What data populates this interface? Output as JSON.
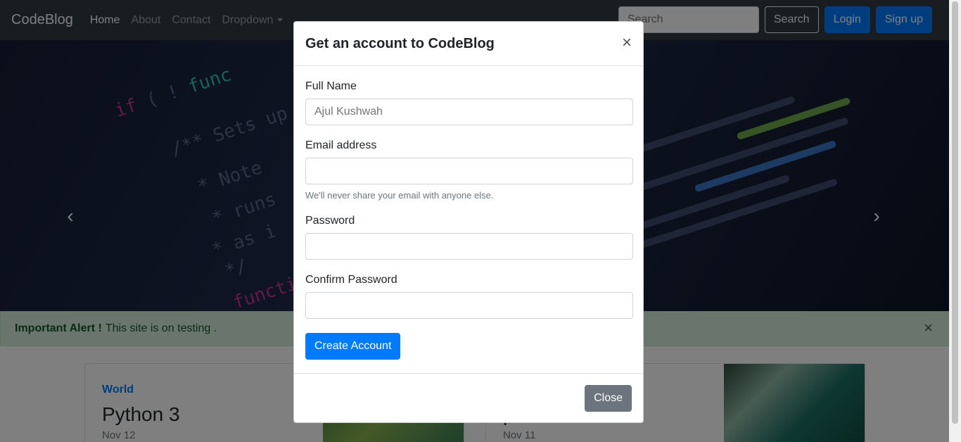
{
  "navbar": {
    "brand": "CodeBlog",
    "links": [
      {
        "label": "Home"
      },
      {
        "label": "About"
      },
      {
        "label": "Contact"
      },
      {
        "label": "Dropdown"
      }
    ],
    "search_placeholder": "Search",
    "search_button": "Search",
    "login_button": "Login",
    "signup_button": "Sign up"
  },
  "carousel": {
    "prev_icon": "chevron-left-icon",
    "next_icon": "chevron-right-icon"
  },
  "alert": {
    "strong": "Important Alert !",
    "text": "This site is on testing .",
    "close": "×"
  },
  "cards": [
    {
      "category": "World",
      "title": "Python 3",
      "date": "Nov 12"
    },
    {
      "category": "",
      "title": "p",
      "date": "Nov 11"
    }
  ],
  "modal": {
    "title": "Get an account to CodeBlog",
    "close_x": "×",
    "fields": {
      "full_name": {
        "label": "Full Name",
        "placeholder": "Ajul Kushwah"
      },
      "email": {
        "label": "Email address",
        "help": "We'll never share your email with anyone else."
      },
      "password": {
        "label": "Password"
      },
      "confirm_password": {
        "label": "Confirm Password"
      }
    },
    "submit": "Create Account",
    "close": "Close"
  },
  "colors": {
    "navbar_bg": "#343a40",
    "primary": "#007bff",
    "secondary": "#6c757d",
    "alert_bg": "#d4edda"
  }
}
